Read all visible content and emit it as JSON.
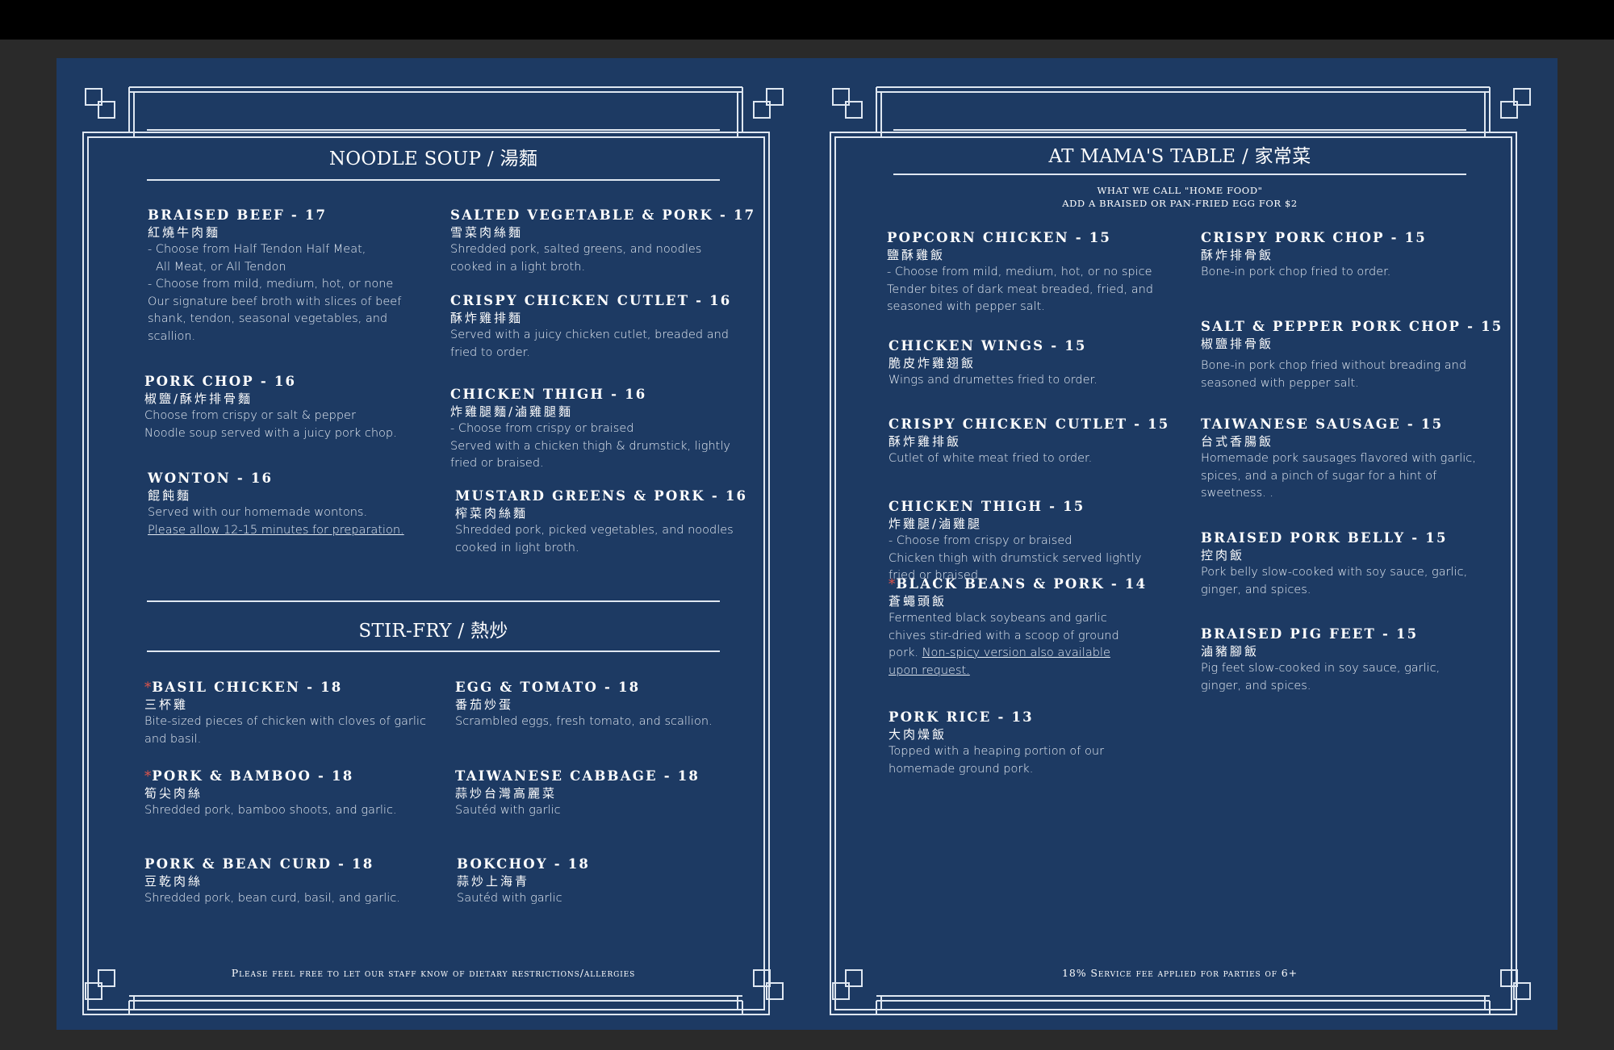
{
  "left": {
    "noodle_title": "NOODLE SOUP / 湯麵",
    "noodle_items": [
      {
        "name": "BRAISED BEEF - 17",
        "zh": "紅燒牛肉麵",
        "desc": [
          "- Choose from Half Tendon Half Meat,",
          "All Meat, or All Tendon",
          "- Choose from mild, medium, hot, or none",
          "Our signature beef broth with slices of beef shank, tendon, seasonal vegetables, and scallion."
        ]
      },
      {
        "name": "SALTED VEGETABLE & PORK - 17",
        "zh": "雪菜肉絲麵",
        "desc": [
          "Shredded pork, salted greens, and noodles cooked in a light broth."
        ]
      },
      {
        "name": "CRISPY CHICKEN CUTLET - 16",
        "zh": "酥炸雞排麵",
        "desc": [
          "Served with a juicy chicken cutlet, breaded and fried to order."
        ]
      },
      {
        "name": "PORK CHOP - 16",
        "zh": "椒鹽/酥炸排骨麵",
        "desc": [
          "Choose from crispy or salt & pepper",
          "Noodle soup served with a juicy pork chop."
        ]
      },
      {
        "name": "CHICKEN THIGH - 16",
        "zh": "炸雞腿麵/滷雞腿麵",
        "desc": [
          "- Choose from crispy or braised",
          "Served with a chicken thigh & drumstick, lightly fried or braised."
        ]
      },
      {
        "name": "WONTON - 16",
        "zh": "餛飩麵",
        "desc": [
          "Served with our homemade wontons.",
          "Please allow 12-15 minutes for preparation."
        ]
      },
      {
        "name": "MUSTARD GREENS & PORK - 16",
        "zh": "榨菜肉絲麵",
        "desc": [
          "Shredded pork, picked vegetables, and noodles cooked in light broth."
        ]
      }
    ],
    "stirfry_title": "STIR-FRY / 熱炒",
    "stirfry_items": [
      {
        "star": "*",
        "name": "BASIL CHICKEN - 18",
        "zh": "三杯雞",
        "desc": [
          "Bite-sized pieces of chicken with cloves of garlic and basil."
        ]
      },
      {
        "name": "EGG & TOMATO - 18",
        "zh": "番茄炒蛋",
        "desc": [
          "Scrambled eggs, fresh tomato, and scallion."
        ]
      },
      {
        "star": "*",
        "name": "PORK & BAMBOO - 18",
        "zh": "筍尖肉絲",
        "desc": [
          "Shredded pork, bamboo shoots, and garlic."
        ]
      },
      {
        "name": "TAIWANESE CABBAGE - 18",
        "zh": "蒜炒台灣高麗菜",
        "desc": [
          "Sautéd with garlic"
        ]
      },
      {
        "name": "PORK & BEAN CURD - 18",
        "zh": "豆乾肉絲",
        "desc": [
          "Shredded pork, bean curd, basil, and garlic."
        ]
      },
      {
        "name": "BOKCHOY - 18",
        "zh": "蒜炒上海青",
        "desc": [
          "Sautéd with garlic"
        ]
      }
    ],
    "footer": "Please feel free to let our staff know of dietary restrictions/allergies"
  },
  "right": {
    "title": "AT MAMA'S TABLE / 家常菜",
    "sub1": "What we call \"home food\"",
    "sub2": "Add a braised or pan-fried egg for $2",
    "items": [
      {
        "name": "POPCORN CHICKEN - 15",
        "zh": "鹽酥雞飯",
        "desc": [
          "- Choose from mild, medium, hot, or no spice",
          "Tender bites of dark meat breaded, fried, and seasoned with pepper salt."
        ]
      },
      {
        "name": "CRISPY PORK CHOP - 15",
        "zh": "酥炸排骨飯",
        "desc": [
          "Bone-in pork chop fried to order."
        ]
      },
      {
        "name": "SALT & PEPPER PORK CHOP - 15",
        "zh": "椒鹽排骨飯",
        "desc": [
          "Bone-in pork chop fried without breading and seasoned with pepper salt."
        ]
      },
      {
        "name": "CHICKEN WINGS - 15",
        "zh": "脆皮炸雞翅飯",
        "desc": [
          "Wings and drumettes fried to order."
        ]
      },
      {
        "name": "CRISPY CHICKEN CUTLET - 15",
        "zh": "酥炸雞排飯",
        "desc": [
          "Cutlet of white meat fried to order."
        ]
      },
      {
        "name": "TAIWANESE SAUSAGE - 15",
        "zh": "台式香腸飯",
        "desc": [
          "Homemade pork sausages flavored with garlic, spices, and a pinch of sugar for a hint of sweetness. ."
        ]
      },
      {
        "name": "CHICKEN THIGH - 15",
        "zh": "炸雞腿/滷雞腿",
        "desc": [
          "- Choose from crispy or braised",
          "Chicken thigh with drumstick served lightly fried or braised."
        ]
      },
      {
        "name": "BRAISED PORK BELLY - 15",
        "zh": "控肉飯",
        "desc": [
          "Pork belly slow-cooked with soy sauce, garlic, ginger, and spices."
        ]
      },
      {
        "star": "*",
        "name": "BLACK BEANS & PORK - 14",
        "zh": "蒼蠅頭飯",
        "desc": [
          "Fermented black soybeans and garlic chives stir-dried with a scoop of ground pork.",
          "Non-spicy version also available upon request."
        ]
      },
      {
        "name": "BRAISED PIG FEET - 15",
        "zh": "滷豬腳飯",
        "desc": [
          "Pig feet slow-cooked in soy sauce, garlic, ginger, and spices."
        ]
      },
      {
        "name": "PORK RICE - 13",
        "zh": "大肉燥飯",
        "desc": [
          "Topped with a heaping portion of our homemade ground pork."
        ]
      }
    ],
    "footer": "18% Service fee applied for parties of 6+"
  }
}
